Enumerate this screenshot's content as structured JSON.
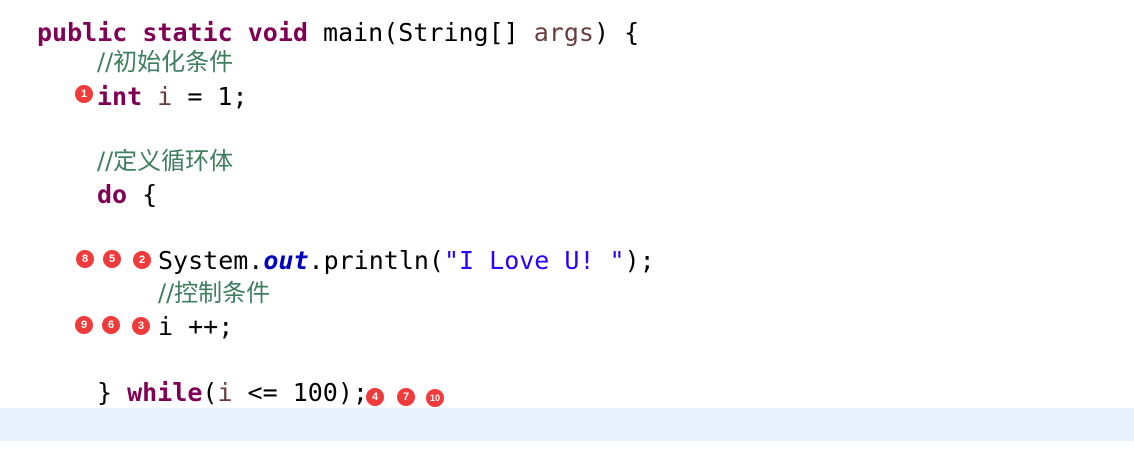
{
  "code": {
    "header_tokens": [
      "public",
      "static",
      "void",
      "main(String[] ",
      "args",
      ") {"
    ],
    "comment_init": "//初始化条件",
    "decl_kw": "int",
    "decl_var": "i",
    "decl_rest": " = 1;",
    "comment_loop": "//定义循环体",
    "do_kw": "do",
    "do_brace": " {",
    "sys_class": "System.",
    "sys_field": "out",
    "sys_method": ".println(",
    "sys_string": "\"I Love U! \"",
    "sys_end": ");",
    "comment_ctrl": "//控制条件",
    "inc_stmt": "i ++;",
    "close_brace": "} ",
    "while_kw": "while",
    "while_paren": "(",
    "while_var": "i",
    "while_rest": " <= 100);"
  },
  "markers": {
    "m1": "1",
    "m2": "2",
    "m3": "3",
    "m4": "4",
    "m5": "5",
    "m6": "6",
    "m7": "7",
    "m8": "8",
    "m9": "9",
    "m10": "10"
  },
  "colors": {
    "keyword": "#7f0055",
    "comment": "#3f7f5f",
    "string": "#2a00ff",
    "field": "#0000c0",
    "marker": "#ef3b3b",
    "current_line": "#e8f2fe"
  }
}
